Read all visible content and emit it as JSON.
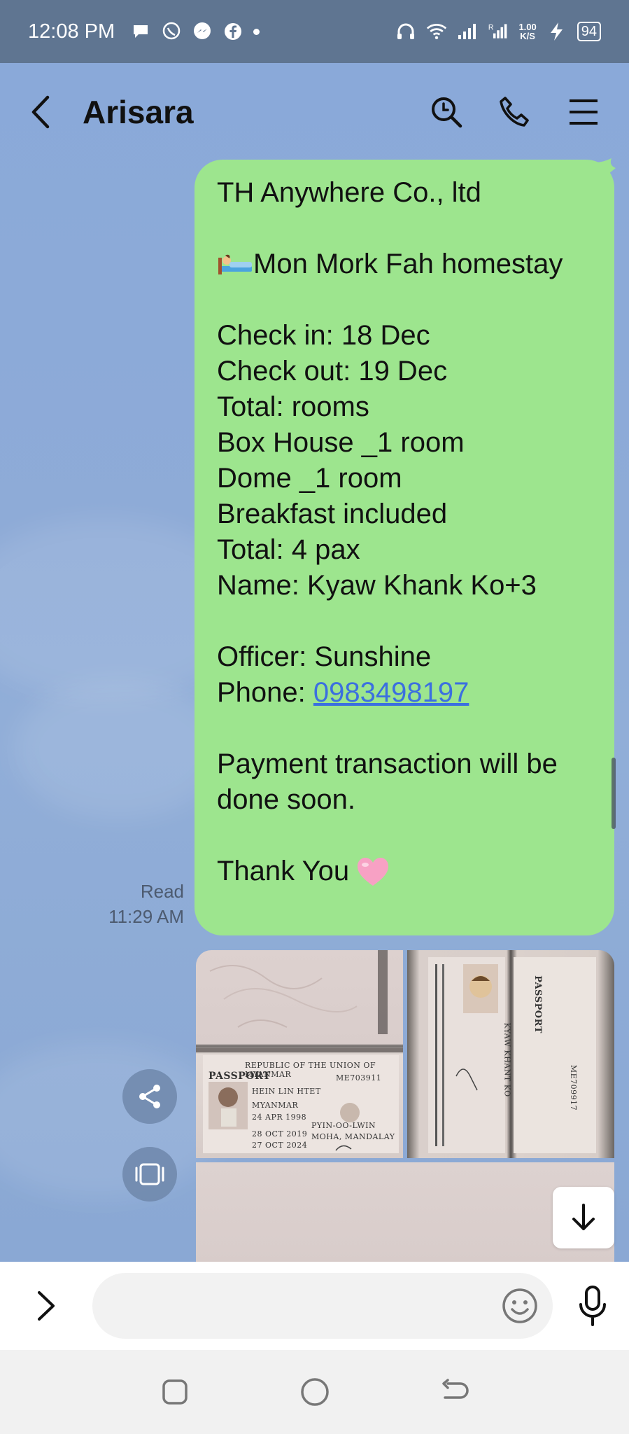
{
  "status_bar": {
    "time": "12:08 PM",
    "speed_value": "1.00",
    "speed_unit": "K/S",
    "battery": "94",
    "icons": [
      "chat-bubble-icon",
      "viber-icon",
      "messenger-icon",
      "facebook-icon",
      "dot-icon",
      "headphones-icon",
      "wifi-icon",
      "signal-icon",
      "signal-r-icon",
      "charging-icon",
      "battery-icon"
    ]
  },
  "header": {
    "title": "Arisara",
    "icons": [
      "back-arrow-icon",
      "search-icon",
      "phone-icon",
      "menu-icon"
    ]
  },
  "message": {
    "company": "TH Anywhere Co., ltd",
    "hotel": "Mon Mork Fah homestay",
    "check_in": "Check in: 18 Dec",
    "check_out": "Check out: 19 Dec",
    "total_rooms": "Total: rooms",
    "room1": "Box House _1 room",
    "room2": "Dome _1 room",
    "breakfast": "Breakfast included",
    "pax": "Total: 4 pax",
    "name": "Name: Kyaw Khank Ko+3",
    "officer": "Officer: Sunshine",
    "phone_label": "Phone: ",
    "phone_number": "0983498197",
    "payment": "Payment transaction will be done soon.",
    "thanks": "Thank You",
    "status": "Read",
    "time": "11:29 AM"
  },
  "images": {
    "passport1_country": "REPUBLIC OF THE UNION OF MYANMAR",
    "passport1_title": "PASSPORT",
    "passport1_name": "HEIN LIN HTET",
    "passport1_nationality": "MYANMAR",
    "passport1_dob": "24 APR 1998",
    "passport1_issue": "28 OCT 2019",
    "passport1_expiry": "27 OCT 2024",
    "passport1_place": "PYIN-OO-LWIN",
    "passport1_authority": "MOHA, MANDALAY",
    "passport1_number": "ME703911",
    "passport2_title": "PASSPORT",
    "passport2_name": "KYAW KHANT KO",
    "passport2_number": "ME709917"
  },
  "input": {
    "placeholder": ""
  },
  "nav": {
    "icons": [
      "recents-icon",
      "home-icon",
      "back-icon"
    ]
  }
}
